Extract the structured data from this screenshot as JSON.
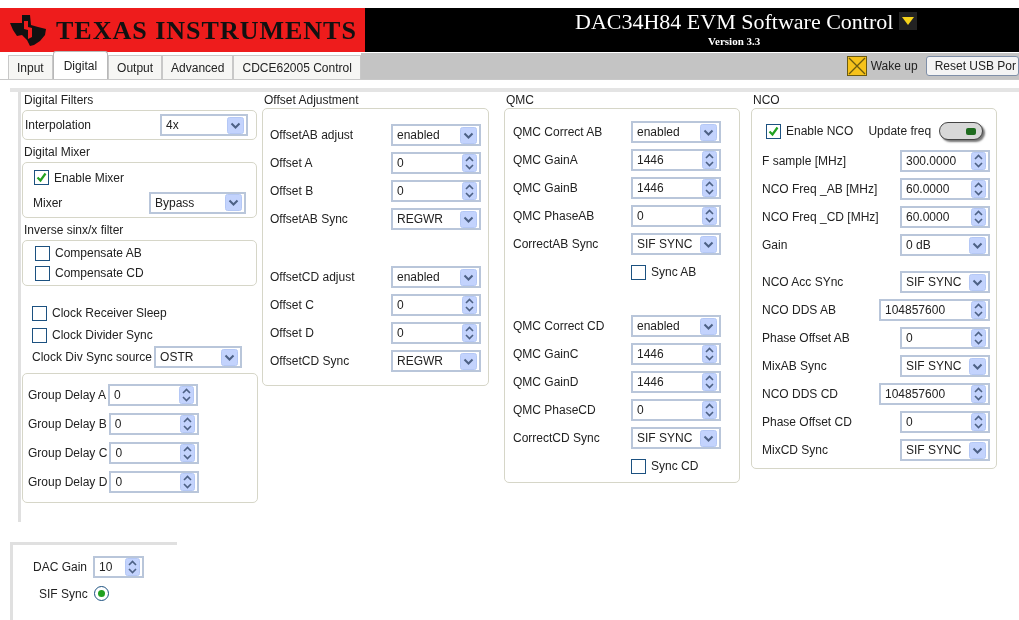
{
  "header": {
    "logo_text": "TEXAS INSTRUMENTS",
    "title": "DAC34H84 EVM Software Control",
    "version": "Version 3.3"
  },
  "tabs": [
    {
      "label": "Input",
      "selected": false
    },
    {
      "label": "Digital",
      "selected": true
    },
    {
      "label": "Output",
      "selected": false
    },
    {
      "label": "Advanced",
      "selected": false
    },
    {
      "label": "CDCE62005 Control",
      "selected": false
    }
  ],
  "wake_up": {
    "label": "Wake up",
    "on": true
  },
  "reset_button": "Reset USB Por",
  "digital_filters": {
    "title": "Digital Filters",
    "rows": [
      {
        "kind": "dropdown",
        "label": "Interpolation",
        "value": "4x"
      }
    ]
  },
  "digital_mixer": {
    "title": "Digital Mixer",
    "rows": [
      {
        "kind": "checkbox",
        "label": "Enable Mixer",
        "checked": true
      },
      {
        "kind": "dropdown",
        "label": "Mixer",
        "value": "Bypass"
      }
    ]
  },
  "inverse_sinc": {
    "title": "Inverse sinx/x filter",
    "rows": [
      {
        "kind": "checkbox",
        "label": "Compensate AB",
        "checked": false
      },
      {
        "kind": "checkbox",
        "label": "Compensate CD",
        "checked": false
      }
    ]
  },
  "clock": {
    "rows": [
      {
        "kind": "checkbox",
        "label": "Clock Receiver Sleep",
        "checked": false
      },
      {
        "kind": "checkbox",
        "label": "Clock Divider Sync",
        "checked": false
      },
      {
        "kind": "dropdown",
        "label": "Clock Div Sync source",
        "value": "OSTR"
      }
    ]
  },
  "group_delay": {
    "rows": [
      {
        "kind": "numeric",
        "label": "Group Delay A",
        "value": "0"
      },
      {
        "kind": "numeric",
        "label": "Group Delay B",
        "value": "0"
      },
      {
        "kind": "numeric",
        "label": "Group Delay C",
        "value": "0"
      },
      {
        "kind": "numeric",
        "label": "Group Delay D",
        "value": "0"
      }
    ]
  },
  "offset_adjustment": {
    "title": "Offset Adjustment",
    "groups": [
      [
        {
          "kind": "dropdown",
          "label": "OffsetAB adjust",
          "value": "enabled"
        },
        {
          "kind": "numeric",
          "label": "Offset A",
          "value": "0"
        },
        {
          "kind": "numeric",
          "label": "Offset B",
          "value": "0"
        },
        {
          "kind": "dropdown",
          "label": "OffsetAB Sync",
          "value": "REGWR"
        }
      ],
      [
        {
          "kind": "dropdown",
          "label": "OffsetCD adjust",
          "value": "enabled"
        },
        {
          "kind": "numeric",
          "label": "Offset C",
          "value": "0"
        },
        {
          "kind": "numeric",
          "label": "Offset D",
          "value": "0"
        },
        {
          "kind": "dropdown",
          "label": "OffsetCD Sync",
          "value": "REGWR"
        }
      ]
    ]
  },
  "qmc": {
    "title": "QMC",
    "groups": [
      [
        {
          "kind": "dropdown",
          "label": "QMC Correct AB",
          "value": "enabled"
        },
        {
          "kind": "numeric",
          "label": "QMC GainA",
          "value": "1446"
        },
        {
          "kind": "numeric",
          "label": "QMC GainB",
          "value": "1446"
        },
        {
          "kind": "numeric",
          "label": "QMC PhaseAB",
          "value": "0"
        },
        {
          "kind": "dropdown",
          "label": "CorrectAB Sync",
          "value": "SIF SYNC"
        },
        {
          "kind": "checkbox",
          "label": "Sync AB",
          "checked": false
        }
      ],
      [
        {
          "kind": "dropdown",
          "label": "QMC Correct CD",
          "value": "enabled"
        },
        {
          "kind": "numeric",
          "label": "QMC GainC",
          "value": "1446"
        },
        {
          "kind": "numeric",
          "label": "QMC GainD",
          "value": "1446"
        },
        {
          "kind": "numeric",
          "label": "QMC PhaseCD",
          "value": "0"
        },
        {
          "kind": "dropdown",
          "label": "CorrectCD Sync",
          "value": "SIF SYNC"
        },
        {
          "kind": "checkbox",
          "label": "Sync CD",
          "checked": false
        }
      ]
    ]
  },
  "nco": {
    "title": "NCO",
    "enable": {
      "label": "Enable NCO",
      "checked": true
    },
    "update_freq": {
      "label": "Update freq",
      "on": false
    },
    "groups": [
      [
        {
          "kind": "numeric",
          "label": "F sample [MHz]",
          "value": "300.0000"
        },
        {
          "kind": "numeric",
          "label": "NCO Freq _AB [MHz]",
          "value": "60.0000"
        },
        {
          "kind": "numeric",
          "label": "NCO Freq _CD [MHz]",
          "value": "60.0000"
        },
        {
          "kind": "dropdown",
          "label": "Gain",
          "value": "0 dB"
        }
      ],
      [
        {
          "kind": "dropdown",
          "label": "NCO Acc SYnc",
          "value": "SIF SYNC"
        },
        {
          "kind": "numeric",
          "label": "NCO DDS AB",
          "value": "104857600"
        },
        {
          "kind": "numeric",
          "label": "Phase Offset AB",
          "value": "0"
        },
        {
          "kind": "dropdown",
          "label": "MixAB Sync",
          "value": "SIF SYNC"
        },
        {
          "kind": "numeric",
          "label": "NCO DDS CD",
          "value": "104857600"
        },
        {
          "kind": "numeric",
          "label": "Phase Offset CD",
          "value": "0"
        },
        {
          "kind": "dropdown",
          "label": "MixCD Sync",
          "value": "SIF SYNC"
        }
      ]
    ]
  },
  "dac": {
    "rows": [
      {
        "kind": "numeric",
        "label": "DAC Gain",
        "value": "10"
      },
      {
        "kind": "radio",
        "label": "SIF Sync",
        "selected": true
      }
    ]
  }
}
